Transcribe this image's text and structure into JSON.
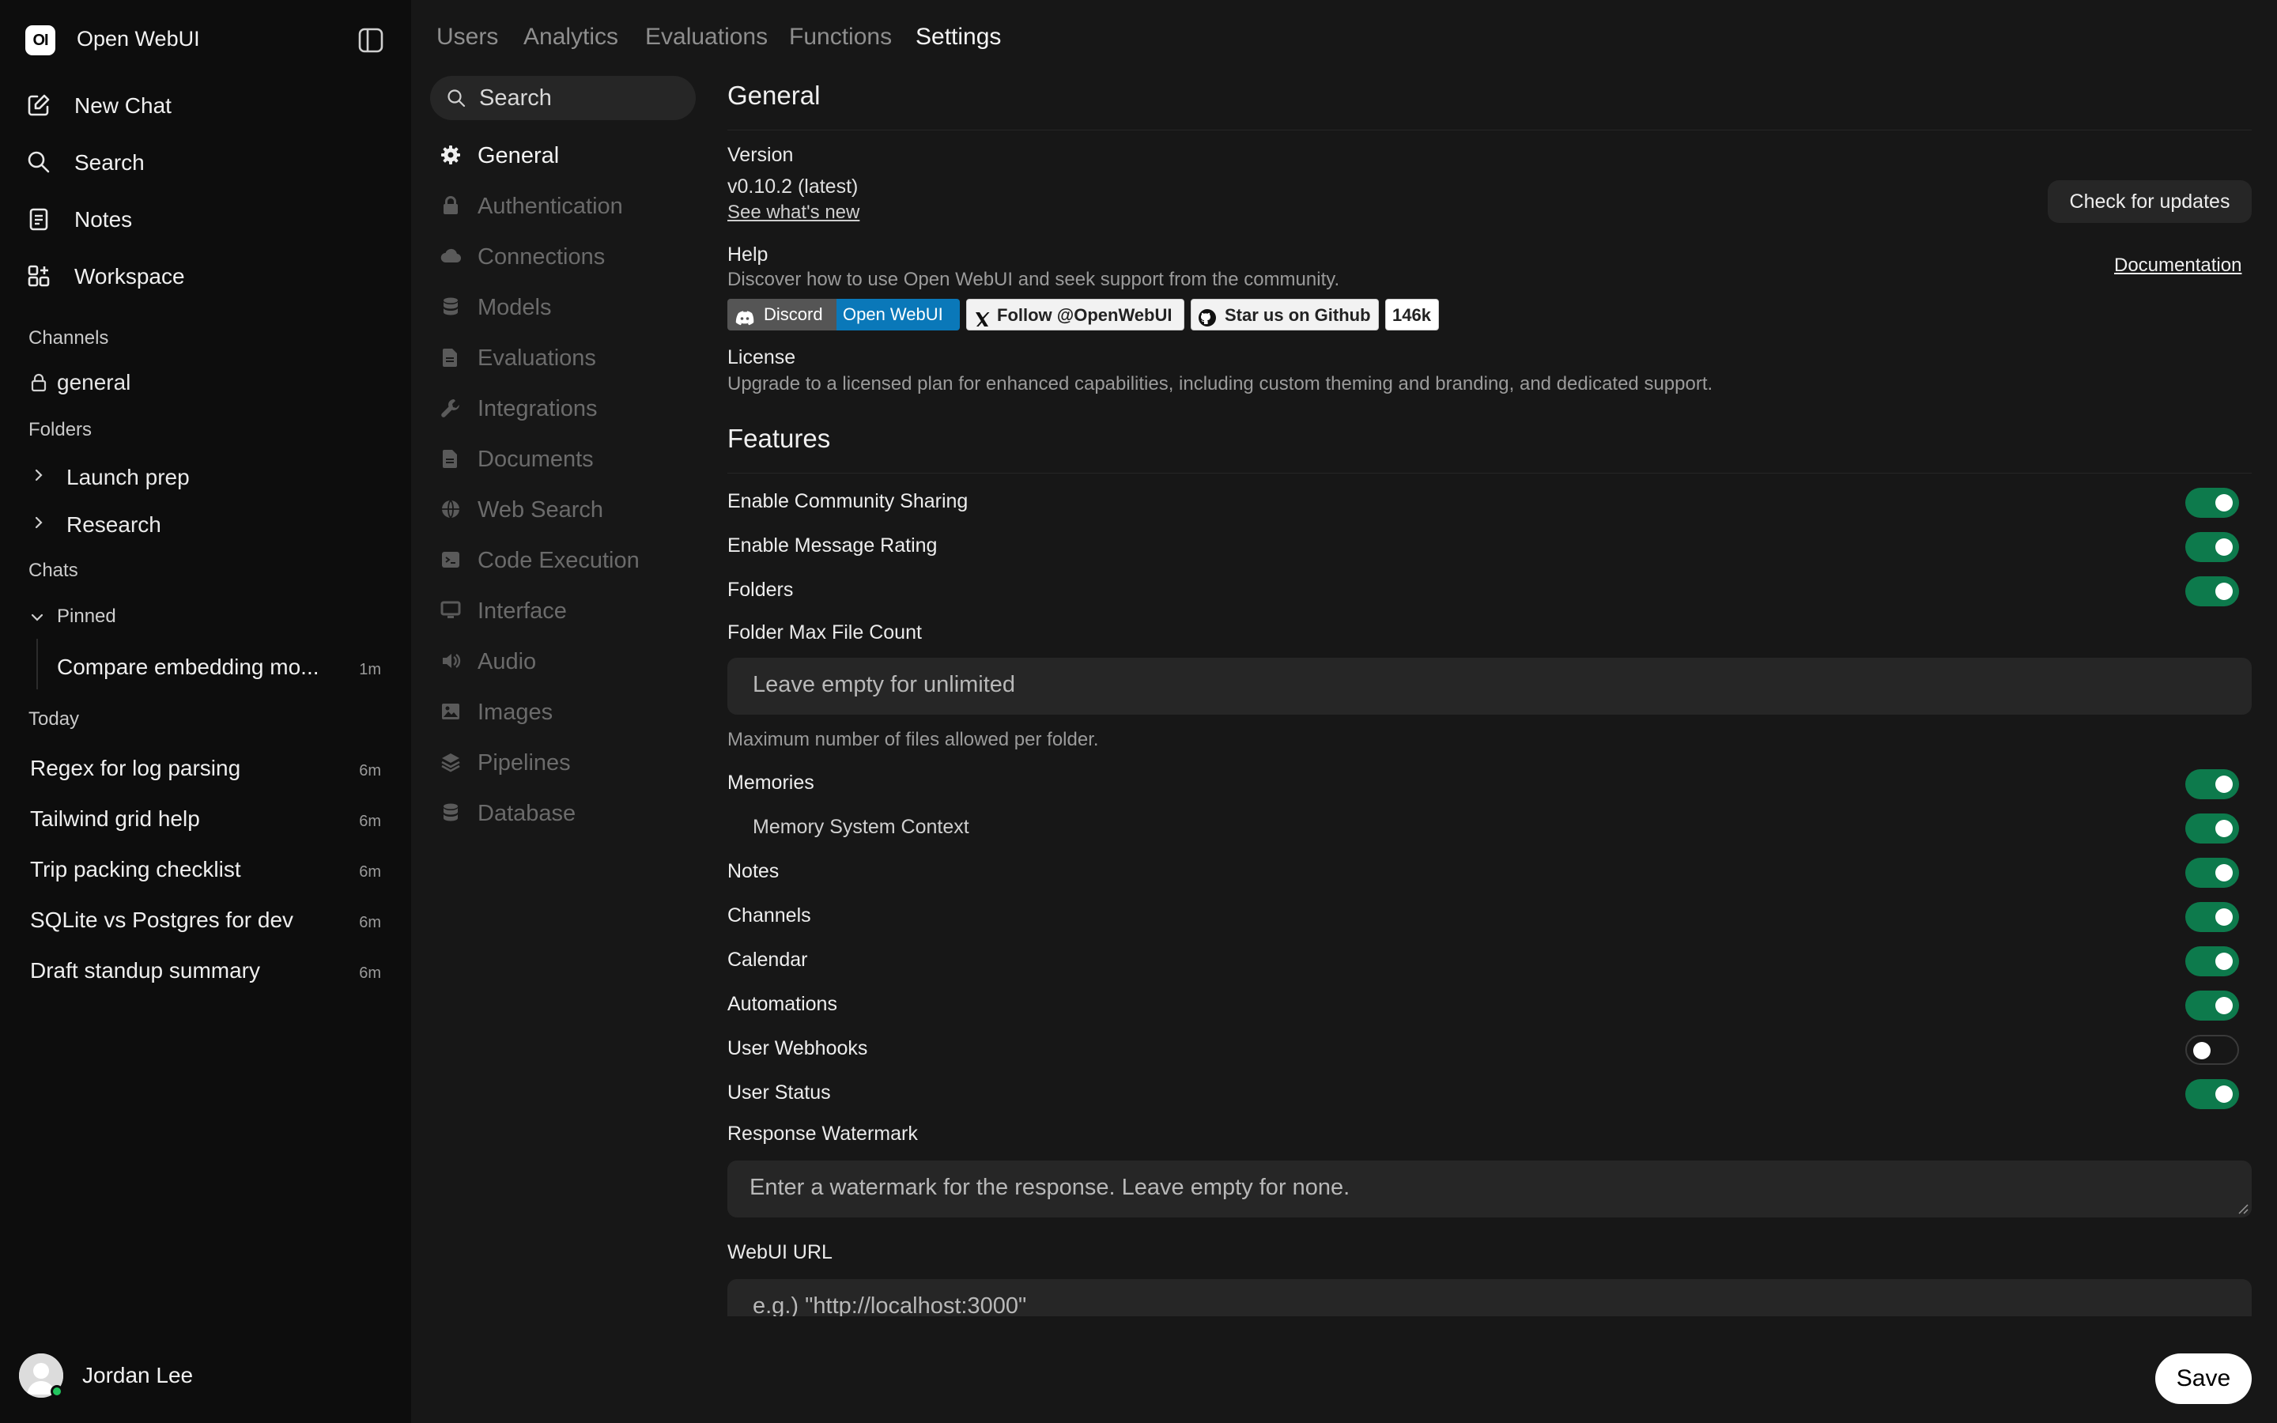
{
  "app": {
    "logo_text": "OI",
    "title": "Open WebUI"
  },
  "sidebar": {
    "nav": [
      {
        "label": "New Chat",
        "icon": "pencil-square-icon"
      },
      {
        "label": "Search",
        "icon": "search-icon"
      },
      {
        "label": "Notes",
        "icon": "notes-icon"
      },
      {
        "label": "Workspace",
        "icon": "grid-plus-icon"
      }
    ],
    "channels_heading": "Channels",
    "channels": [
      {
        "name": "general",
        "icon": "lock-icon"
      }
    ],
    "folders_heading": "Folders",
    "folders": [
      {
        "name": "Launch prep"
      },
      {
        "name": "Research"
      }
    ],
    "chats_heading": "Chats",
    "pinned_heading": "Pinned",
    "pinned": [
      {
        "title": "Compare embedding mo...",
        "time": "1m"
      }
    ],
    "today_heading": "Today",
    "today": [
      {
        "title": "Regex for log parsing",
        "time": "6m"
      },
      {
        "title": "Tailwind grid help",
        "time": "6m"
      },
      {
        "title": "Trip packing checklist",
        "time": "6m"
      },
      {
        "title": "SQLite vs Postgres for dev",
        "time": "6m"
      },
      {
        "title": "Draft standup summary",
        "time": "6m"
      }
    ],
    "user": {
      "name": "Jordan Lee",
      "status_color": "#22c55e"
    }
  },
  "top_tabs": [
    {
      "label": "Users",
      "active": false
    },
    {
      "label": "Analytics",
      "active": false
    },
    {
      "label": "Evaluations",
      "active": false
    },
    {
      "label": "Functions",
      "active": false
    },
    {
      "label": "Settings",
      "active": true
    }
  ],
  "settings_nav": {
    "search_placeholder": "Search",
    "items": [
      {
        "label": "General",
        "icon": "gear-icon",
        "active": true
      },
      {
        "label": "Authentication",
        "icon": "lock-icon",
        "active": false
      },
      {
        "label": "Connections",
        "icon": "cloud-icon",
        "active": false
      },
      {
        "label": "Models",
        "icon": "database-icon",
        "active": false
      },
      {
        "label": "Evaluations",
        "icon": "document-icon",
        "active": false
      },
      {
        "label": "Integrations",
        "icon": "wrench-icon",
        "active": false
      },
      {
        "label": "Documents",
        "icon": "document-icon",
        "active": false
      },
      {
        "label": "Web Search",
        "icon": "globe-icon",
        "active": false
      },
      {
        "label": "Code Execution",
        "icon": "terminal-icon",
        "active": false
      },
      {
        "label": "Interface",
        "icon": "monitor-icon",
        "active": false
      },
      {
        "label": "Audio",
        "icon": "speaker-icon",
        "active": false
      },
      {
        "label": "Images",
        "icon": "image-icon",
        "active": false
      },
      {
        "label": "Pipelines",
        "icon": "layers-icon",
        "active": false
      },
      {
        "label": "Database",
        "icon": "database-icon",
        "active": false
      }
    ]
  },
  "general": {
    "heading": "General",
    "version_label": "Version",
    "version_value": "v0.10.2 (latest)",
    "whats_new_link": "See what's new",
    "check_updates_button": "Check for updates",
    "help_label": "Help",
    "help_text": "Discover how to use Open WebUI and seek support from the community.",
    "documentation_link": "Documentation",
    "badges": {
      "discord_left": "Discord",
      "discord_right": "Open WebUI",
      "follow": "Follow @OpenWebUI",
      "star": "Star us on Github",
      "star_count": "146k"
    },
    "license_label": "License",
    "license_text": "Upgrade to a licensed plan for enhanced capabilities, including custom theming and branding, and dedicated support."
  },
  "features": {
    "heading": "Features",
    "community_sharing": {
      "label": "Enable Community Sharing",
      "enabled": true
    },
    "message_rating": {
      "label": "Enable Message Rating",
      "enabled": true
    },
    "folders": {
      "label": "Folders",
      "enabled": true
    },
    "folder_max_label": "Folder Max File Count",
    "folder_max_placeholder": "Leave empty for unlimited",
    "folder_max_help": "Maximum number of files allowed per folder.",
    "memories": {
      "label": "Memories",
      "enabled": true
    },
    "memory_system_context": {
      "label": "Memory System Context",
      "enabled": true
    },
    "notes": {
      "label": "Notes",
      "enabled": true
    },
    "channels": {
      "label": "Channels",
      "enabled": true
    },
    "calendar": {
      "label": "Calendar",
      "enabled": true
    },
    "automations": {
      "label": "Automations",
      "enabled": true
    },
    "user_webhooks": {
      "label": "User Webhooks",
      "enabled": false
    },
    "user_status": {
      "label": "User Status",
      "enabled": true
    },
    "watermark_label": "Response Watermark",
    "watermark_placeholder": "Enter a watermark for the response. Leave empty for none.",
    "webui_url_label": "WebUI URL",
    "webui_url_placeholder": "e.g.) \"http://localhost:3000\""
  },
  "save_button": "Save",
  "colors": {
    "toggle_on": "#0d7a4c",
    "discord_left": "#555555",
    "discord_right": "#0a78b9",
    "page_bg": "#171717",
    "sidebar_bg": "#0d0d0d"
  }
}
